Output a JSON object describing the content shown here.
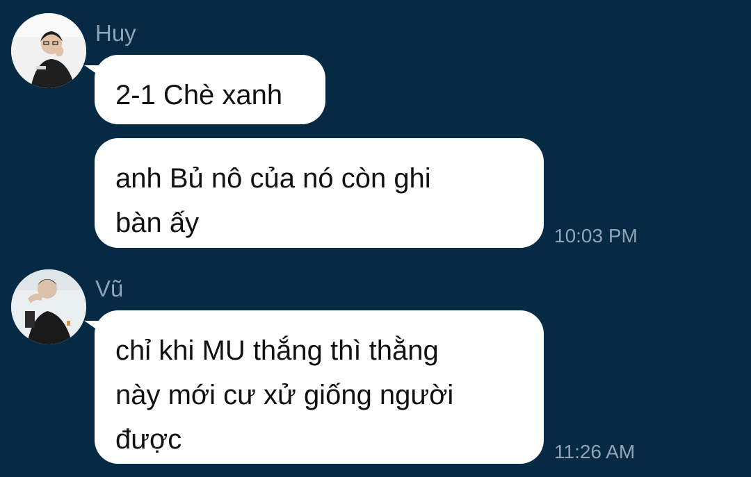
{
  "messages": [
    {
      "sender": "Huy",
      "avatar": "huy-avatar",
      "bubbles": [
        {
          "text": "2-1 Chè xanh",
          "time": ""
        },
        {
          "text": "anh Bủ nô của nó còn ghi\nbàn ấy",
          "time": "10:03 PM"
        }
      ]
    },
    {
      "sender": "Vũ",
      "avatar": "vu-avatar",
      "bubbles": [
        {
          "text": "chỉ khi MU thắng thì thằng\nnày mới cư xử giống người\nđược",
          "time": "11:26 AM"
        }
      ]
    }
  ],
  "colors": {
    "background": "#062a43",
    "bubble": "#ffffff",
    "meta_text": "#8ea3b5"
  }
}
